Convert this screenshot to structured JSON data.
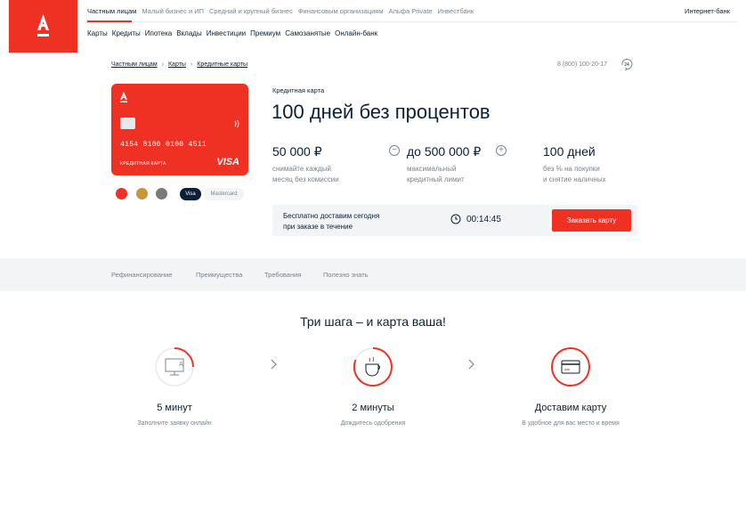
{
  "brand": {
    "logo_letter": "А",
    "accent_color": "#ef3124"
  },
  "top_nav": {
    "items": [
      "Частным лицам",
      "Малый бизнес и ИП",
      "Средний и крупный бизнес",
      "Финансовым организациям",
      "Альфа Private",
      "Инвестбанк"
    ],
    "active_index": 0,
    "internet_bank": "Интернет-банк"
  },
  "sub_nav": {
    "items": [
      "Карты",
      "Кредиты",
      "Ипотека",
      "Вклады",
      "Инвестиции",
      "Премиум",
      "Самозанятые",
      "Онлайн-банк"
    ]
  },
  "breadcrumb": [
    "Частным лицам",
    "Карты",
    "Кредитные карты"
  ],
  "phone": "8 (800) 100-20-17",
  "phone_icon_label": "24",
  "card": {
    "number": "4154 8100 0100 4511",
    "type_label": "КРЕДИТНАЯ КАРТА",
    "network": "VISA",
    "colors": [
      "#ef3124",
      "#c9963a",
      "#7a7a7a"
    ],
    "systems": [
      "Visa",
      "Mastercard"
    ],
    "selected_system": "Visa"
  },
  "product": {
    "category": "Кредитная карта",
    "title": "100 дней без процентов"
  },
  "features": [
    {
      "value": "50 000 ₽",
      "desc_line1": "снимайте каждый",
      "desc_line2": "месяц без комиссии"
    },
    {
      "value": "до 500 000 ₽",
      "desc_line1": "максимальный",
      "desc_line2": "кредитный лимит"
    },
    {
      "value": "100 дней",
      "desc_line1": "без % на покупки",
      "desc_line2": "и снятие наличных"
    }
  ],
  "stepper": {
    "minus": "−",
    "plus": "+"
  },
  "delivery": {
    "line1": "Бесплатно доставим сегодня",
    "line2": "при заказе в течение",
    "timer": "00:14:45",
    "button": "Заказать карту"
  },
  "tabs": [
    "Рефинансирование",
    "Преимущества",
    "Требования",
    "Полезно знать"
  ],
  "steps_section": {
    "title": "Три шага – и карта ваша!",
    "steps": [
      {
        "title": "5 минут",
        "desc": "Заполните заявку онлайн",
        "icon": "monitor-icon"
      },
      {
        "title": "2 минуты",
        "desc": "Дождитесь одобрения",
        "icon": "coffee-cup-icon"
      },
      {
        "title": "Доставим карту",
        "desc": "В удобное для вас место и время",
        "icon": "card-icon"
      }
    ]
  }
}
